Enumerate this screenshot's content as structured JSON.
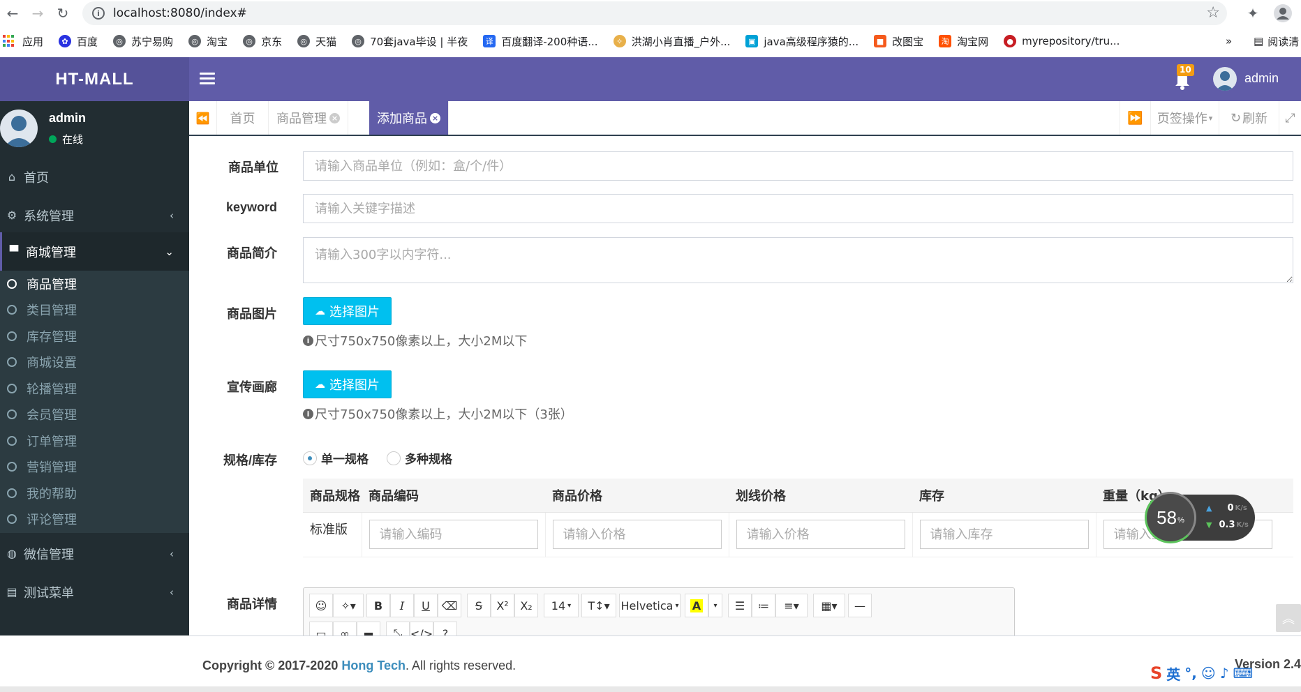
{
  "browser": {
    "url": "localhost:8080/index#",
    "bookmarks": [
      "应用",
      "百度",
      "苏宁易购",
      "淘宝",
      "京东",
      "天猫",
      "70套java毕设 | 半夜",
      "百度翻译-200种语...",
      "洪湖小肖直播_户外...",
      "java高级程序猿的...",
      "改图宝",
      "淘宝网",
      "myrepository/tru..."
    ],
    "more": "»",
    "reading_list": "阅读清"
  },
  "header": {
    "logo": "HT-MALL",
    "notification_count": "10",
    "username": "admin"
  },
  "sidebar": {
    "user_name": "admin",
    "user_status": "在线",
    "items": [
      {
        "label": "首页",
        "icon": "home-icon"
      },
      {
        "label": "系统管理",
        "icon": "cogs-icon"
      },
      {
        "label": "商城管理",
        "icon": "shopping-bag-icon"
      },
      {
        "label": "微信管理",
        "icon": "wechat-icon"
      },
      {
        "label": "测试菜单",
        "icon": "id-card-icon"
      }
    ],
    "submenu": [
      "商品管理",
      "类目管理",
      "库存管理",
      "商城设置",
      "轮播管理",
      "会员管理",
      "订单管理",
      "营销管理",
      "我的帮助",
      "评论管理"
    ]
  },
  "tabs": {
    "items": [
      "首页",
      "商品管理",
      "添加商品"
    ],
    "page_ops": "页签操作",
    "refresh": "刷新"
  },
  "form": {
    "unit_label": "商品单位",
    "unit_placeholder": "请输入商品单位（例如：盒/个/件）",
    "keyword_label": "keyword",
    "keyword_placeholder": "请输入关键字描述",
    "intro_label": "商品简介",
    "intro_placeholder": "请输入300字以内字符...",
    "image_label": "商品图片",
    "upload_btn": "选择图片",
    "image_hint": "尺寸750x750像素以上，大小2M以下",
    "gallery_label": "宣传画廊",
    "gallery_hint": "尺寸750x750像素以上，大小2M以下（3张）",
    "spec_label": "规格/库存",
    "spec_single": "单一规格",
    "spec_multi": "多种规格",
    "detail_label": "商品详情"
  },
  "spec_table": {
    "headers": [
      "商品规格",
      "商品编码",
      "商品价格",
      "划线价格",
      "库存",
      "重量（kg）"
    ],
    "row_name": "标准版",
    "placeholders": [
      "请输入编码",
      "请输入价格",
      "请输入价格",
      "请输入库存",
      "请输入重量"
    ]
  },
  "editor": {
    "font_size": "14",
    "font_family": "Helvetica"
  },
  "speed_widget": {
    "percent": "58",
    "percent_unit": "%",
    "up": "0",
    "down": "0.3",
    "unit": "K/s"
  },
  "footer": {
    "copyright": "Copyright © 2017-2020",
    "company": "Hong Tech",
    "rights": ". All rights reserved.",
    "version": "Version 2.4"
  },
  "colors": {
    "header": "#605ca8",
    "logo_bg": "#555299",
    "sidebar": "#222d32",
    "upload_btn": "#00c0ef"
  }
}
